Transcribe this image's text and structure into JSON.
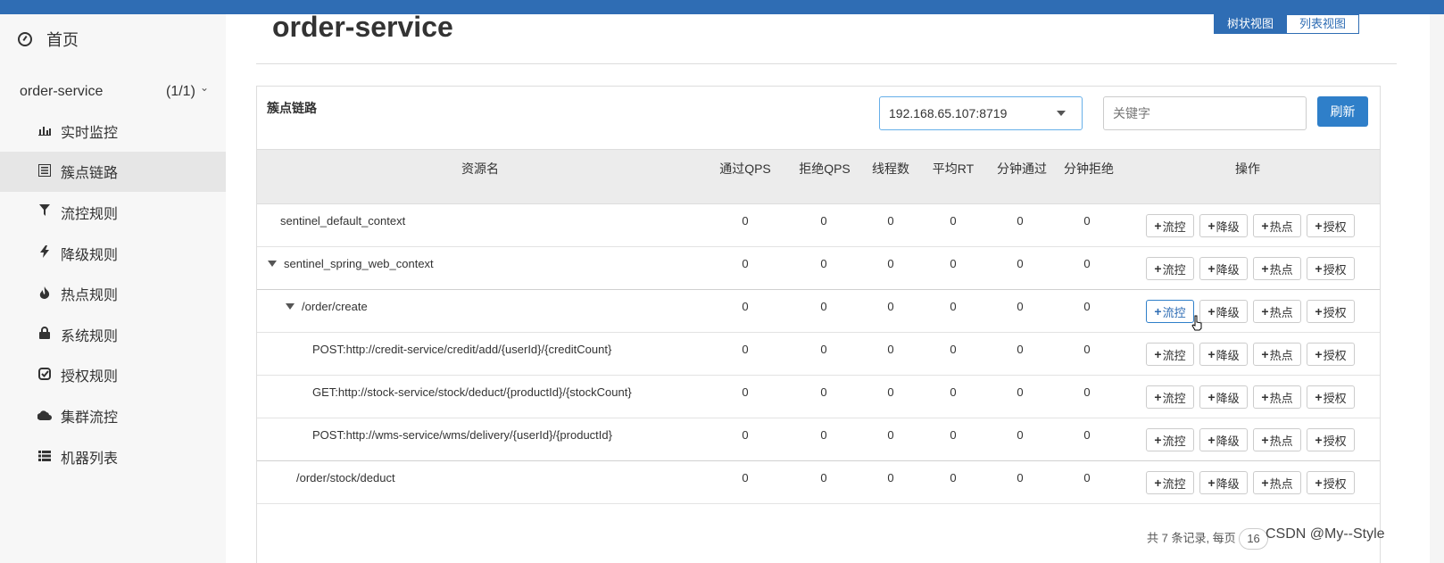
{
  "sidebar": {
    "home_label": "首页",
    "app_name": "order-service",
    "app_count": "(1/1)",
    "items": [
      {
        "label": "实时监控",
        "icon": "bar-chart-icon"
      },
      {
        "label": "簇点链路",
        "icon": "list-icon",
        "active": true
      },
      {
        "label": "流控规则",
        "icon": "filter-icon"
      },
      {
        "label": "降级规则",
        "icon": "bolt-icon"
      },
      {
        "label": "热点规则",
        "icon": "fire-icon"
      },
      {
        "label": "系统规则",
        "icon": "lock-icon"
      },
      {
        "label": "授权规则",
        "icon": "check-square-icon"
      },
      {
        "label": "集群流控",
        "icon": "cloud-icon"
      },
      {
        "label": "机器列表",
        "icon": "th-list-icon"
      }
    ]
  },
  "header": {
    "title": "order-service",
    "tree_view": "树状视图",
    "list_view": "列表视图"
  },
  "panel": {
    "title": "簇点链路",
    "machine": "192.168.65.107:8719",
    "search_placeholder": "关键字",
    "refresh": "刷新"
  },
  "table": {
    "columns": [
      "资源名",
      "通过QPS",
      "拒绝QPS",
      "线程数",
      "平均RT",
      "分钟通过",
      "分钟拒绝",
      "操作"
    ],
    "op_labels": [
      "流控",
      "降级",
      "热点",
      "授权"
    ],
    "rows": [
      {
        "resource": "sentinel_default_context",
        "pass_qps": "0",
        "block_qps": "0",
        "threads": "0",
        "avg_rt": "0",
        "min_pass": "0",
        "min_block": "0"
      },
      {
        "resource": "sentinel_spring_web_context",
        "pass_qps": "0",
        "block_qps": "0",
        "threads": "0",
        "avg_rt": "0",
        "min_pass": "0",
        "min_block": "0"
      },
      {
        "resource": "/order/create",
        "pass_qps": "0",
        "block_qps": "0",
        "threads": "0",
        "avg_rt": "0",
        "min_pass": "0",
        "min_block": "0"
      },
      {
        "resource": "POST:http://credit-service/credit/add/{userId}/{creditCount}",
        "pass_qps": "0",
        "block_qps": "0",
        "threads": "0",
        "avg_rt": "0",
        "min_pass": "0",
        "min_block": "0"
      },
      {
        "resource": "GET:http://stock-service/stock/deduct/{productId}/{stockCount}",
        "pass_qps": "0",
        "block_qps": "0",
        "threads": "0",
        "avg_rt": "0",
        "min_pass": "0",
        "min_block": "0"
      },
      {
        "resource": "POST:http://wms-service/wms/delivery/{userId}/{productId}",
        "pass_qps": "0",
        "block_qps": "0",
        "threads": "0",
        "avg_rt": "0",
        "min_pass": "0",
        "min_block": "0"
      },
      {
        "resource": "/order/stock/deduct",
        "pass_qps": "0",
        "block_qps": "0",
        "threads": "0",
        "avg_rt": "0",
        "min_pass": "0",
        "min_block": "0"
      }
    ]
  },
  "footer": {
    "summary": "共 7 条记录, 每页",
    "page_size": "16",
    "watermark": "CSDN @My--Style"
  }
}
